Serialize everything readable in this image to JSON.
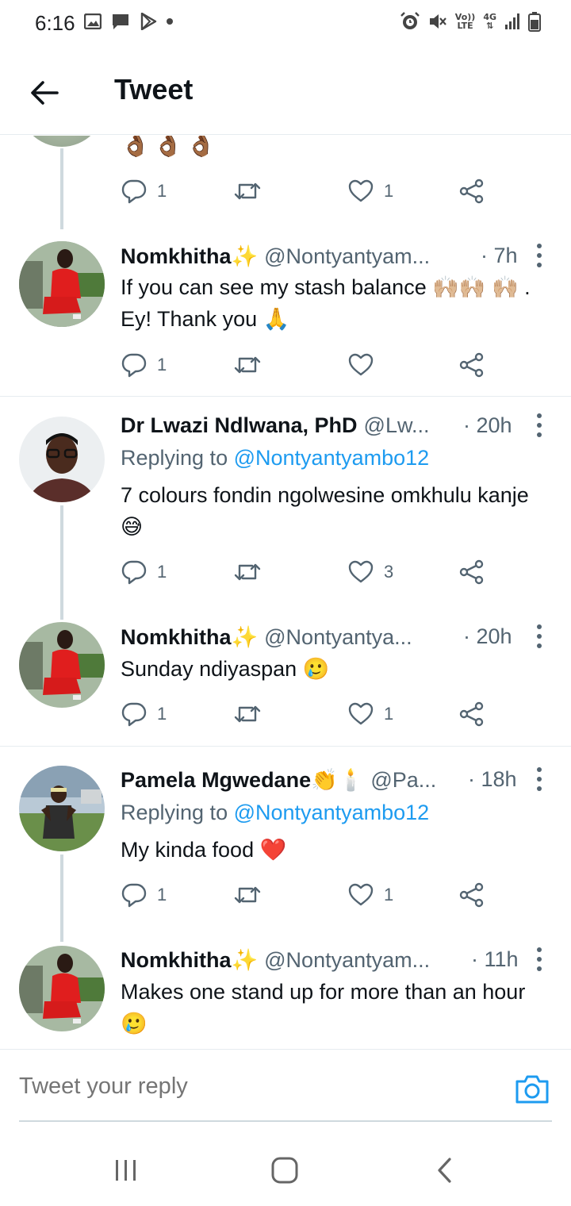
{
  "status_bar": {
    "time": "6:16",
    "left_icons": [
      "gallery-icon",
      "message-icon",
      "play-store-icon",
      "dot-icon"
    ],
    "right_icons": [
      "alarm-icon",
      "mute-icon",
      "volte-icon",
      "4g-icon",
      "signal-icon",
      "battery-icon"
    ],
    "volte_top": "Vo))",
    "volte_bottom": "LTE",
    "network": "4G"
  },
  "header": {
    "title": "Tweet"
  },
  "tweets": [
    {
      "emoji_text": "👌🏾👌🏾👌🏾",
      "actions": {
        "replies": "1",
        "retweets": "",
        "likes": "1"
      }
    },
    {
      "name": "Nomkhitha✨",
      "handle": "@Nontyantyam...",
      "time": "· 7h",
      "text": "If you can see my stash balance 🙌🏼🙌🏼 🙌🏼 . Ey! Thank you 🙏",
      "actions": {
        "replies": "1",
        "retweets": "",
        "likes": ""
      }
    },
    {
      "name": "Dr Lwazi Ndlwana, PhD",
      "handle": "@Lw...",
      "time": "· 20h",
      "replying_prefix": "Replying to",
      "replying_to": "@Nontyantyambo12",
      "text": "7 colours fondin ngolwesine omkhulu kanje 😅",
      "actions": {
        "replies": "1",
        "retweets": "",
        "likes": "3"
      }
    },
    {
      "name": "Nomkhitha✨",
      "handle": "@Nontyantya...",
      "time": "· 20h",
      "text": "Sunday ndiyaspan 🥲",
      "actions": {
        "replies": "1",
        "retweets": "",
        "likes": "1"
      }
    },
    {
      "name": "Pamela Mgwedane👏🕯️",
      "handle": "@Pa...",
      "time": "· 18h",
      "replying_prefix": "Replying to",
      "replying_to": "@Nontyantyambo12",
      "text": "My kinda food ❤️",
      "actions": {
        "replies": "1",
        "retweets": "",
        "likes": "1"
      }
    },
    {
      "name": "Nomkhitha✨",
      "handle": "@Nontyantyam...",
      "time": "· 11h",
      "text": "Makes one stand up for more than an hour 🥲"
    }
  ],
  "reply_bar": {
    "placeholder": "Tweet your reply"
  },
  "colors": {
    "accent": "#1d9bf0",
    "text_primary": "#0f1419",
    "text_secondary": "#536471",
    "divider": "#e6ecf0",
    "thread_line": "#cfd9de"
  }
}
